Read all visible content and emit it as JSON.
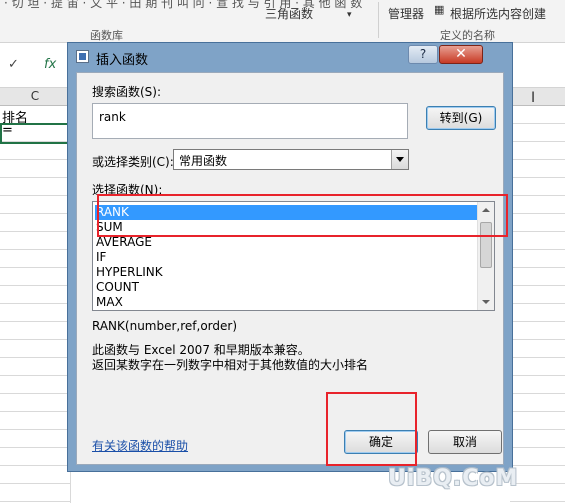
{
  "ribbon": {
    "top_left_text": "· 切 坦 · 提 宙 · 又 平 · 田 期 刊 叫 问 · 宣 找 与 引 用 · 其 他 函 数",
    "mid_text": "三角函数",
    "group_library": "函数库",
    "manager_label": "管理器",
    "create_from_selection": "根据所选内容创建",
    "group_defined_names": "定义的名称"
  },
  "formula_bar": {
    "cancel_icon": "check-icon",
    "fx_label": "fx"
  },
  "sheet": {
    "column_c": "C",
    "cell_header_text": "排名",
    "cell_formula_text": "="
  },
  "dialog": {
    "title": "插入函数",
    "help_glyph": "?",
    "close_glyph": "✕",
    "search_label": "搜索函数(S):",
    "search_value": "rank",
    "goto_label": "转到(G)",
    "category_label": "或选择类别(C):",
    "category_value": "常用函数",
    "select_label": "选择函数(N):",
    "functions": [
      "RANK",
      "SUM",
      "AVERAGE",
      "IF",
      "HYPERLINK",
      "COUNT",
      "MAX"
    ],
    "selected_index": 0,
    "signature": "RANK(number,ref,order)",
    "desc_line1": "此函数与 Excel 2007 和早期版本兼容。",
    "desc_line2": "返回某数字在一列数字中相对于其他数值的大小排名",
    "help_link": "有关该函数的帮助",
    "ok_label": "确定",
    "cancel_label": "取消"
  },
  "watermark": "UiBQ.CoM",
  "colors": {
    "selection": "#3399ff",
    "annotation": "#e8232b",
    "dialog_frame": "#7fa3c7",
    "cell_border": "#217346"
  }
}
